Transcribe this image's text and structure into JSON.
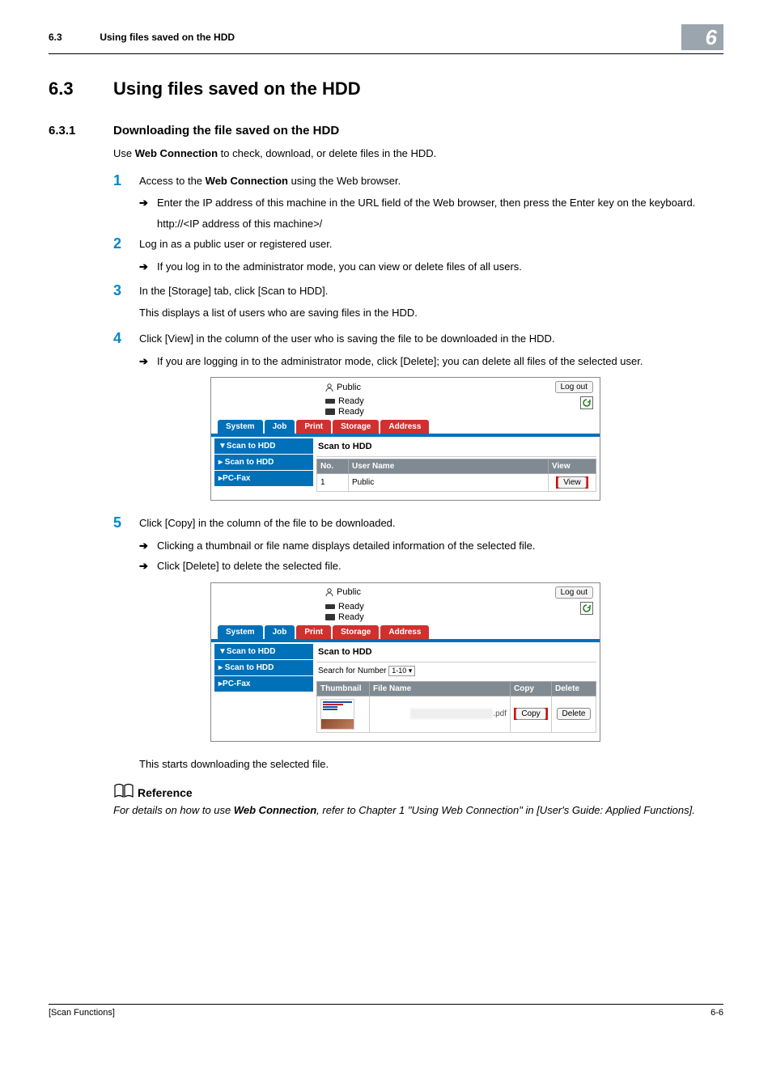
{
  "header": {
    "section_num": "6.3",
    "running_title": "Using files saved on the HDD",
    "chapter_badge": "6"
  },
  "section": {
    "num": "6.3",
    "title": "Using files saved on the HDD"
  },
  "subsection": {
    "num": "6.3.1",
    "title": "Downloading the file saved on the HDD"
  },
  "intro": {
    "pre": "Use ",
    "bold": "Web Connection",
    "post": " to check, download, or delete files in the HDD."
  },
  "steps": {
    "s1": {
      "num": "1",
      "pre": "Access to the ",
      "bold": "Web Connection",
      "post": " using the Web browser.",
      "bullet1": "Enter the IP address of this machine in the URL field of the Web browser, then press the Enter key on the keyboard.",
      "cont": "http://<IP address of this machine>/"
    },
    "s2": {
      "num": "2",
      "text": "Log in as a public user or registered user.",
      "bullet1": "If you log in to the administrator mode, you can view or delete files of all users."
    },
    "s3": {
      "num": "3",
      "text": "In the [Storage] tab, click [Scan to HDD].",
      "cont": "This displays a list of users who are saving files in the HDD."
    },
    "s4": {
      "num": "4",
      "text": "Click [View] in the column of the user who is saving the file to be downloaded in the HDD.",
      "bullet1": "If you are logging in to the administrator mode, click [Delete]; you can delete all files of the selected user."
    },
    "s5": {
      "num": "5",
      "text": "Click [Copy] in the column of the file to be downloaded.",
      "bullet1": "Clicking a thumbnail or file name displays detailed information of the selected file.",
      "bullet2": "Click [Delete] to delete the selected file."
    },
    "closing": "This starts downloading the selected file."
  },
  "screenshot1": {
    "user": "Public",
    "logout": "Log out",
    "ready": "Ready",
    "tabs": {
      "system": "System",
      "job": "Job",
      "print": "Print",
      "storage": "Storage",
      "address": "Address"
    },
    "side": {
      "scan_hdd_open": "▼Scan to HDD",
      "scan_hdd_sub": "▸ Scan to HDD",
      "pcfax": "▸PC-Fax"
    },
    "main_title": "Scan to HDD",
    "th": {
      "no": "No.",
      "user": "User Name",
      "view": "View"
    },
    "row": {
      "no": "1",
      "user": "Public",
      "view": "View"
    }
  },
  "screenshot2": {
    "user": "Public",
    "logout": "Log out",
    "ready": "Ready",
    "tabs": {
      "system": "System",
      "job": "Job",
      "print": "Print",
      "storage": "Storage",
      "address": "Address"
    },
    "side": {
      "scan_hdd_open": "▼Scan to HDD",
      "scan_hdd_sub": "▸ Scan to HDD",
      "pcfax": "▸PC-Fax"
    },
    "main_title": "Scan to HDD",
    "search_label": "Search for Number",
    "search_value": "1-10",
    "th": {
      "thumb": "Thumbnail",
      "file": "File Name",
      "copy": "Copy",
      "delete": "Delete"
    },
    "row": {
      "file": ".pdf",
      "copy": "Copy",
      "delete": "Delete"
    }
  },
  "reference": {
    "label": "Reference",
    "pre": "For details on how to use ",
    "bold": "Web Connection",
    "post": ", refer to Chapter 1 \"Using Web Connection\" in [User's Guide: Applied Functions]."
  },
  "footer": {
    "left": "[Scan Functions]",
    "right": "6-6"
  },
  "glyphs": {
    "arrow": "➔",
    "triangle": "▸"
  }
}
